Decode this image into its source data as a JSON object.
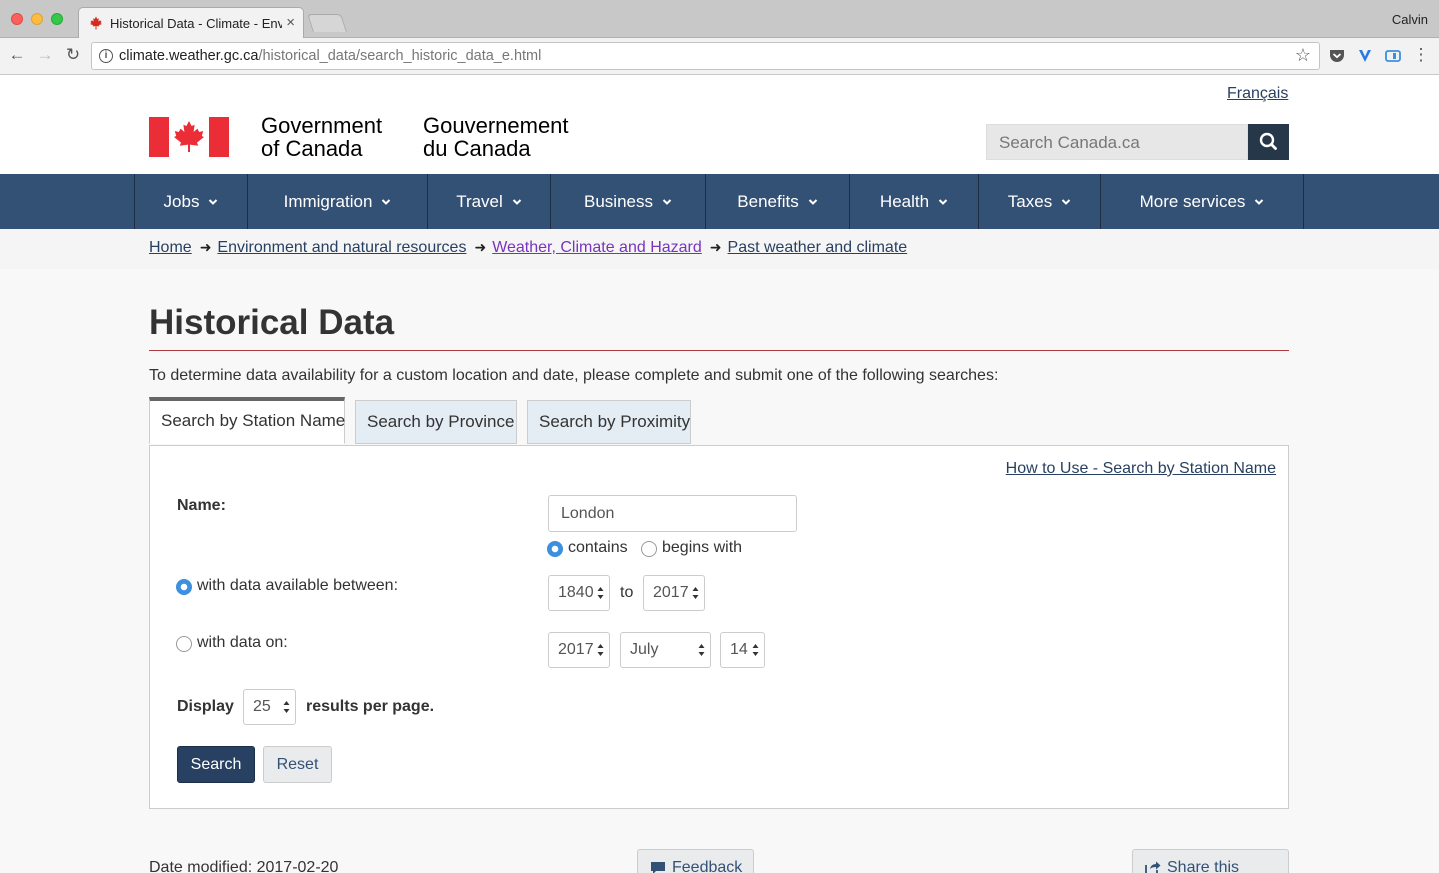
{
  "browser": {
    "tab_title": "Historical Data - Climate - Env",
    "profile_name": "Calvin",
    "url_host": "climate.weather.gc.ca",
    "url_path": "/historical_data/search_historic_data_e.html"
  },
  "header": {
    "language_link": "Français",
    "wordmark_en_line1": "Government",
    "wordmark_en_line2": "of Canada",
    "wordmark_fr_line1": "Gouvernement",
    "wordmark_fr_line2": "du Canada",
    "search_placeholder": "Search Canada.ca",
    "flag_red": "#eb2d37"
  },
  "nav": {
    "items": [
      {
        "label": "Jobs"
      },
      {
        "label": "Immigration"
      },
      {
        "label": "Travel"
      },
      {
        "label": "Business"
      },
      {
        "label": "Benefits"
      },
      {
        "label": "Health"
      },
      {
        "label": "Taxes"
      },
      {
        "label": "More services"
      }
    ],
    "bar_color": "#335075"
  },
  "breadcrumb": {
    "items": [
      "Home",
      "Environment and natural resources",
      "Weather, Climate and Hazard",
      "Past weather and climate"
    ]
  },
  "main": {
    "title": "Historical Data",
    "intro": "To determine data availability for a custom location and date, please complete and submit one of the following searches:",
    "tabs": [
      "Search by Station Name",
      "Search by Province",
      "Search by Proximity"
    ],
    "active_tab": "Search by Station Name",
    "howto_link": "How to Use - Search by Station Name"
  },
  "form": {
    "name_label": "Name:",
    "name_value": "London",
    "match_contains": "contains",
    "match_begins": "begins with",
    "match_selected": "contains",
    "between_label": "with data available between:",
    "between_from": "1840",
    "between_to_word": "to",
    "between_to": "2017",
    "on_label": "with data on:",
    "on_year": "2017",
    "on_month": "July",
    "on_day": "14",
    "date_mode_selected": "between",
    "display_label": "Display",
    "per_page": "25",
    "per_page_suffix": "results per page.",
    "search_button": "Search",
    "reset_button": "Reset"
  },
  "footer": {
    "date_modified": "Date modified: 2017-02-20",
    "feedback_button": "Feedback",
    "share_button": "Share this page"
  }
}
